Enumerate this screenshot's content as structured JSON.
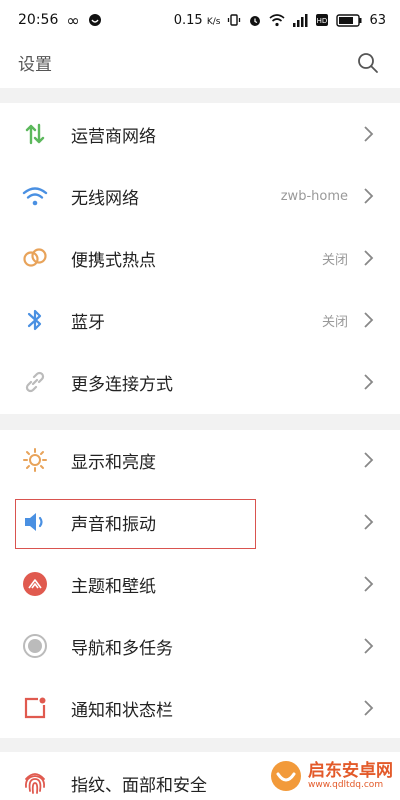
{
  "status_bar": {
    "time": "20:56",
    "infinity_glyph": "∞",
    "speed": "0.15",
    "speed_unit": "K/s",
    "battery": "63"
  },
  "header": {
    "title": "设置"
  },
  "sections": [
    {
      "items": [
        {
          "label": "运营商网络",
          "value": "",
          "icon": "arrows-updown-icon"
        },
        {
          "label": "无线网络",
          "value": "zwb-home",
          "icon": "wifi-icon"
        },
        {
          "label": "便携式热点",
          "value": "关闭",
          "icon": "hotspot-icon"
        },
        {
          "label": "蓝牙",
          "value": "关闭",
          "icon": "bluetooth-icon"
        },
        {
          "label": "更多连接方式",
          "value": "",
          "icon": "link-icon"
        }
      ]
    },
    {
      "items": [
        {
          "label": "显示和亮度",
          "value": "",
          "icon": "sun-icon"
        },
        {
          "label": "声音和振动",
          "value": "",
          "icon": "speaker-icon"
        },
        {
          "label": "主题和壁纸",
          "value": "",
          "icon": "theme-icon"
        },
        {
          "label": "导航和多任务",
          "value": "",
          "icon": "navigation-icon"
        },
        {
          "label": "通知和状态栏",
          "value": "",
          "icon": "notification-icon"
        }
      ]
    },
    {
      "items": [
        {
          "label": "指纹、面部和安全",
          "value": "",
          "icon": "fingerprint-icon"
        }
      ]
    }
  ],
  "watermark": {
    "title": "启东安卓网",
    "url": "www.qdltdq.com"
  },
  "colors": {
    "green": "#5cb85c",
    "blue": "#4a90e2",
    "orange": "#e8a35a",
    "gray": "#b9b9b9",
    "red": "#e05a4f",
    "highlight": "#d9534f"
  }
}
